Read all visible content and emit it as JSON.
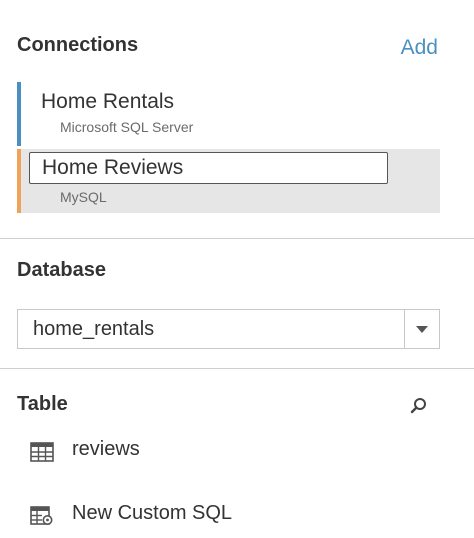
{
  "connections": {
    "heading": "Connections",
    "add_label": "Add",
    "items": [
      {
        "name": "Home Rentals",
        "type": "Microsoft SQL Server",
        "color": "#4b8fc2"
      },
      {
        "name": "Home Reviews",
        "type": "MySQL",
        "color": "#f0a25a"
      }
    ]
  },
  "database": {
    "heading": "Database",
    "selected": "home_rentals"
  },
  "table": {
    "heading": "Table",
    "items": [
      {
        "label": "reviews",
        "icon": "table-icon"
      },
      {
        "label": "New Custom SQL",
        "icon": "custom-sql-icon"
      }
    ]
  }
}
